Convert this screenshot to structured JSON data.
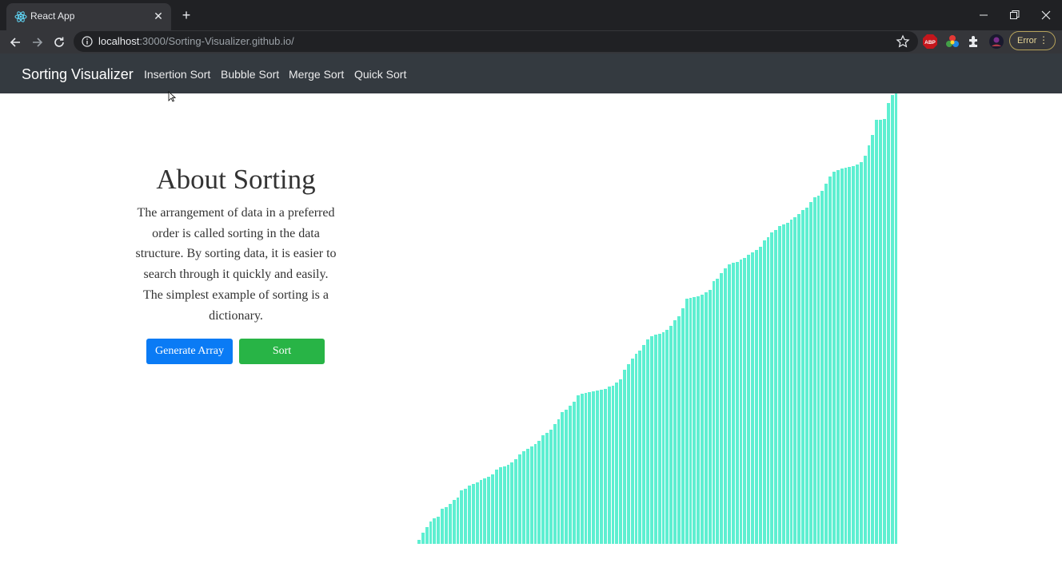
{
  "browser": {
    "tab_title": "React App",
    "url_host": "localhost",
    "url_rest": ":3000/Sorting-Visualizer.github.io/",
    "extension_abp": "ABP",
    "error_label": "Error"
  },
  "navbar": {
    "brand": "Sorting Visualizer",
    "links": [
      "Insertion Sort",
      "Bubble Sort",
      "Merge Sort",
      "Quick Sort"
    ]
  },
  "about": {
    "heading": "About Sorting",
    "body": "The arrangement of data in a preferred order is called sorting in the data structure. By sorting data, it is easier to search through it quickly and easily. The simplest example of sorting is a dictionary."
  },
  "buttons": {
    "generate": "Generate Array",
    "sort": "Sort"
  },
  "colors": {
    "bar": "#5eefd1",
    "navbar": "#343a40",
    "generate_button": "#0a7bf5",
    "sort_button": "#28b446"
  },
  "array_values": [
    5,
    14,
    21,
    28,
    32,
    34,
    44,
    46,
    50,
    55,
    58,
    67,
    69,
    73,
    75,
    77,
    80,
    82,
    84,
    87,
    93,
    96,
    97,
    99,
    102,
    106,
    112,
    116,
    119,
    122,
    125,
    129,
    136,
    139,
    143,
    150,
    156,
    165,
    168,
    173,
    178,
    186,
    188,
    189,
    190,
    191,
    192,
    193,
    194,
    197,
    198,
    202,
    206,
    218,
    225,
    232,
    238,
    242,
    249,
    256,
    260,
    262,
    263,
    265,
    268,
    273,
    280,
    285,
    295,
    307,
    308,
    309,
    310,
    312,
    315,
    318,
    329,
    332,
    339,
    345,
    350,
    352,
    353,
    356,
    358,
    362,
    365,
    368,
    372,
    380,
    384,
    390,
    393,
    398,
    400,
    402,
    406,
    409,
    413,
    418,
    421,
    428,
    434,
    436,
    442,
    451,
    460,
    466,
    468,
    470,
    471,
    472,
    473,
    475,
    478,
    486,
    499,
    512,
    531,
    531,
    532,
    552,
    562,
    564
  ]
}
